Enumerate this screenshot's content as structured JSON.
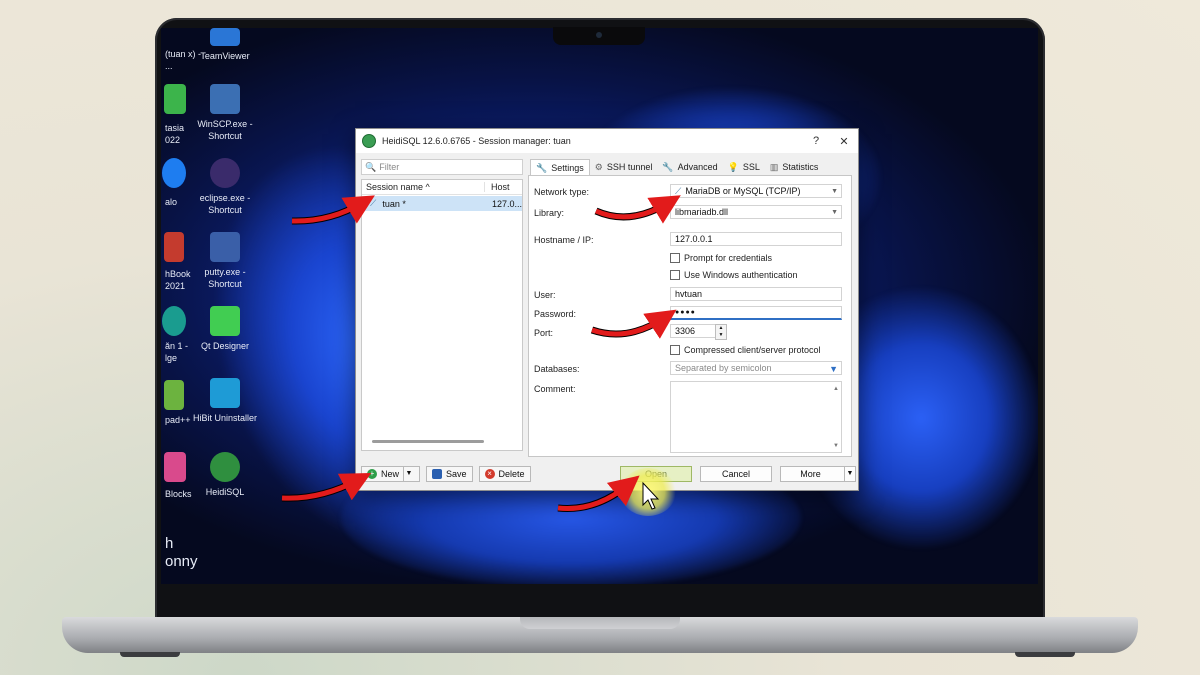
{
  "desktop": {
    "icons": [
      {
        "label": "TeamViewer",
        "color": "#2a76d6"
      },
      {
        "label": "WinSCP.exe - Shortcut",
        "color": "#3b6fb3"
      },
      {
        "label": "eclipse.exe - Shortcut",
        "color": "#3a2b6b"
      },
      {
        "label": "putty.exe - Shortcut",
        "color": "#3a5fa8"
      },
      {
        "label": "Qt Designer",
        "color": "#41cd52"
      },
      {
        "label": "HiBit Uninstaller",
        "color": "#1e9bd6"
      },
      {
        "label": "HeidiSQL",
        "color": "#2f8f3f"
      }
    ],
    "partial_icons": [
      {
        "label": "(tuan x) - ...",
        "color": "#3d3d3d"
      },
      {
        "label": "tasia 022",
        "color": "#3cb44b"
      },
      {
        "label": "alo",
        "color": "#1e7df0"
      },
      {
        "label": "hBook 2021",
        "color": "#c43b2e"
      },
      {
        "label": "ăn 1 - lge",
        "color": "#1a9c8f"
      },
      {
        "label": "pad++",
        "color": "#6cb33f"
      },
      {
        "label": "Blocks",
        "color": "#d94a8c"
      },
      {
        "label": "h onny",
        "color": "#2a2a2a"
      }
    ]
  },
  "dialog": {
    "title": "HeidiSQL 12.6.0.6765 - Session manager: tuan",
    "help": "?",
    "close": "✕",
    "filter_placeholder": "Filter",
    "columns": {
      "session": "Session name ^",
      "host": "Host"
    },
    "session": {
      "name": "tuan *",
      "host": "127.0..."
    },
    "left_buttons": {
      "new": "New",
      "save": "Save",
      "delete": "Delete"
    },
    "tabs": [
      "Settings",
      "SSH tunnel",
      "Advanced",
      "SSL",
      "Statistics"
    ],
    "settings": {
      "network_type_label": "Network type:",
      "network_type": "MariaDB or MySQL (TCP/IP)",
      "library_label": "Library:",
      "library": "libmariadb.dll",
      "hostname_label": "Hostname / IP:",
      "hostname": "127.0.0.1",
      "prompt_credentials": "Prompt for credentials",
      "windows_auth": "Use Windows authentication",
      "user_label": "User:",
      "user": "hvtuan",
      "password_label": "Password:",
      "password": "●●●●",
      "port_label": "Port:",
      "port": "3306",
      "compressed": "Compressed client/server protocol",
      "databases_label": "Databases:",
      "databases_placeholder": "Separated by semicolon",
      "comment_label": "Comment:"
    },
    "bottom_buttons": {
      "open": "Open",
      "cancel": "Cancel",
      "more": "More"
    }
  },
  "colors": {
    "arrow": "#e21b1b",
    "accent": "#2f6fc4",
    "highlight": "#f2ee5c"
  }
}
